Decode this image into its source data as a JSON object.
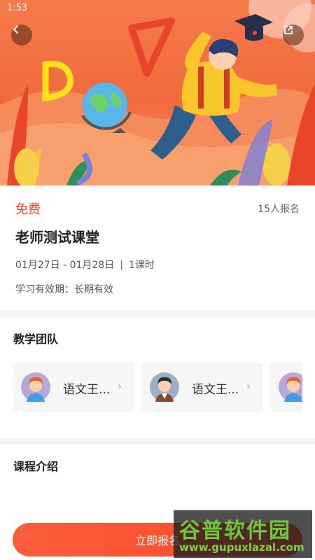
{
  "status_bar": {
    "time": "1:53"
  },
  "course": {
    "price": "免费",
    "enrolled": "15人报名",
    "title": "老师测试课堂",
    "date_range": "01月27日 - 01月28日",
    "lesson_count": "1课时",
    "validity": "学习有效期：长期有效"
  },
  "team": {
    "title": "教学团队",
    "teachers": [
      {
        "name": "语文王..."
      },
      {
        "name": "语文王..."
      }
    ]
  },
  "intro": {
    "title": "课程介绍"
  },
  "footer": {
    "enroll_label": "立即报名"
  },
  "watermark": {
    "brand": "谷普软件园",
    "url": "www.gupuxlazal.com"
  },
  "colors": {
    "accent": "#f0442b",
    "button": "#fb5d3a",
    "hero": "#f26a3c"
  }
}
